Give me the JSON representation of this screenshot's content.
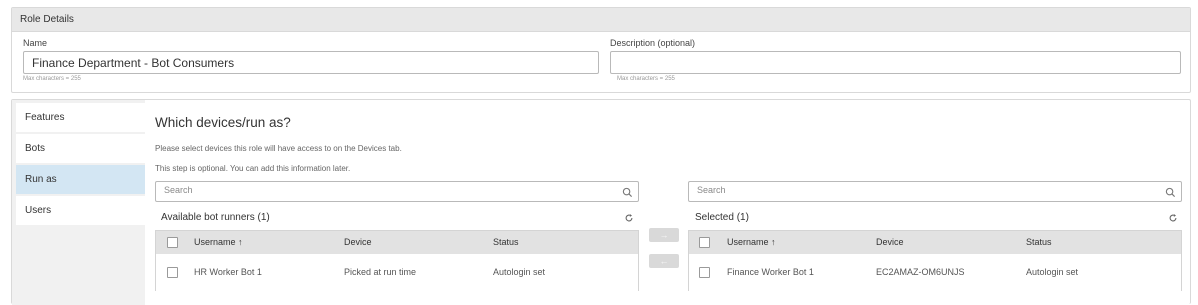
{
  "role_details": {
    "header": "Role Details",
    "name_label": "Name",
    "name_value": "Finance Department - Bot Consumers",
    "name_hint": "Max characters = 255",
    "description_label": "Description (optional)",
    "description_value": "",
    "description_hint": "Max characters = 255"
  },
  "nav": {
    "items": [
      {
        "label": "Features"
      },
      {
        "label": "Bots"
      },
      {
        "label": "Run as"
      },
      {
        "label": "Users"
      }
    ],
    "active": "Run as"
  },
  "step": {
    "title": "Which devices/run as?",
    "line1": "Please select devices this role will have access to on the Devices tab.",
    "line2": "This step is optional. You can add this information later."
  },
  "available": {
    "search_placeholder": "Search",
    "title": "Available bot runners (1)",
    "columns": {
      "username": "Username ↑",
      "device": "Device",
      "status": "Status"
    },
    "rows": [
      {
        "username": "HR Worker Bot 1",
        "device": "Picked at run time",
        "status": "Autologin set"
      }
    ]
  },
  "selected": {
    "search_placeholder": "Search",
    "title": "Selected (1)",
    "columns": {
      "username": "Username ↑",
      "device": "Device",
      "status": "Status"
    },
    "rows": [
      {
        "username": "Finance Worker Bot 1",
        "device": "EC2AMAZ-OM6UNJS",
        "status": "Autologin set"
      }
    ]
  },
  "transfer": {
    "add_glyph": "→",
    "remove_glyph": "←"
  },
  "icons": {
    "search": "search-icon",
    "refresh": "refresh-icon",
    "sort": "sort-up-arrow-icon"
  }
}
